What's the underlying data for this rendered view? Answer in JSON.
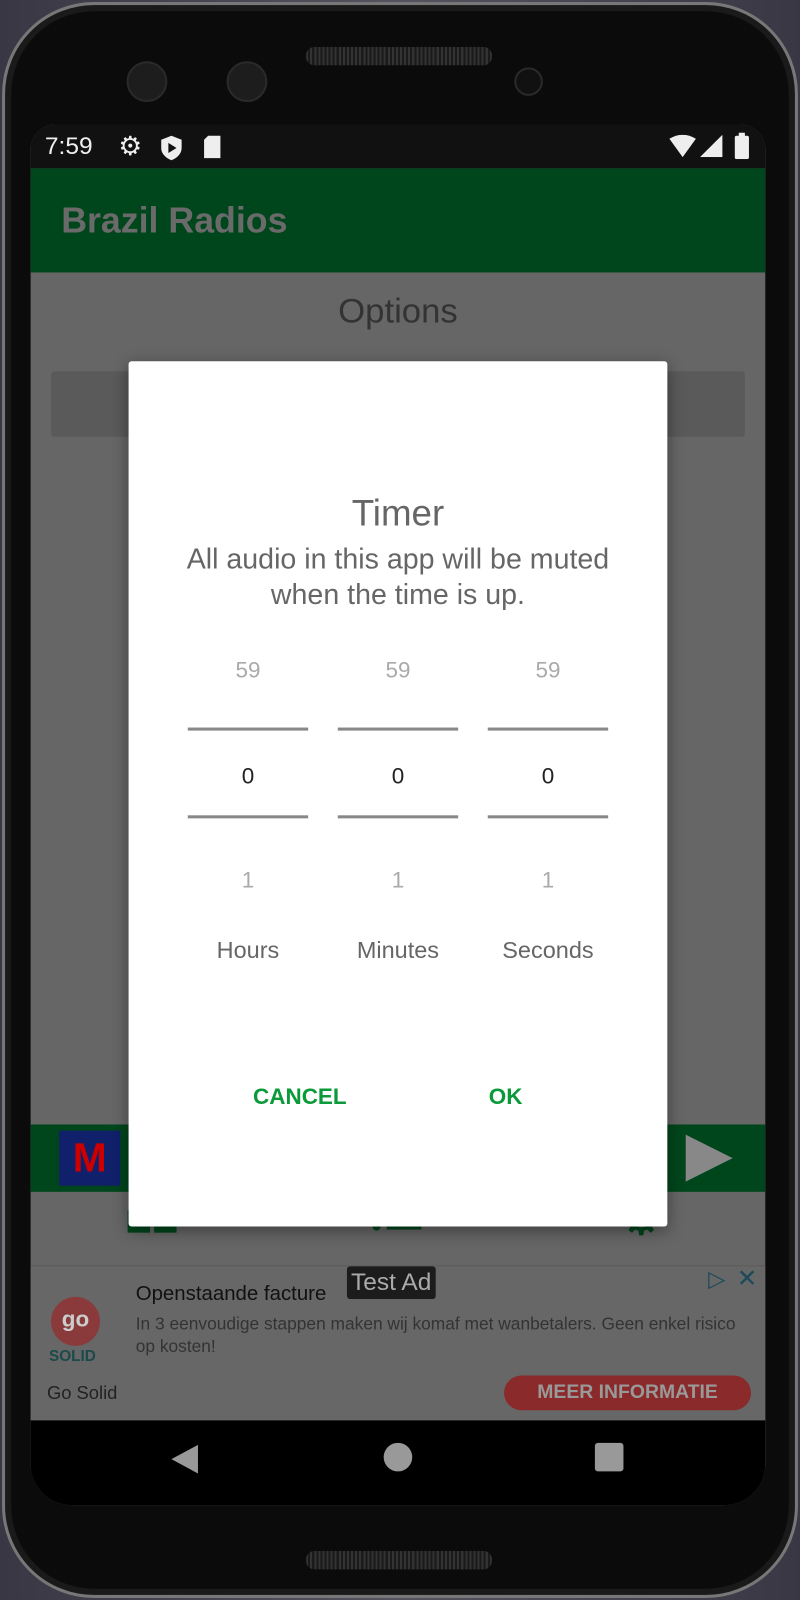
{
  "status_bar": {
    "time": "7:59",
    "icons": [
      "gear-icon",
      "shield-play-icon",
      "sd-card-icon",
      "wifi-icon",
      "signal-icon",
      "battery-icon"
    ]
  },
  "app_bar": {
    "title": "Brazil Radios"
  },
  "page": {
    "title": "Options"
  },
  "dialog": {
    "title": "Timer",
    "message": "All audio in this app will be muted when the time is up.",
    "pickers": [
      {
        "label": "Hours",
        "prev": "59",
        "value": "0",
        "next": "1"
      },
      {
        "label": "Minutes",
        "prev": "59",
        "value": "0",
        "next": "1"
      },
      {
        "label": "Seconds",
        "prev": "59",
        "value": "0",
        "next": "1"
      }
    ],
    "cancel_label": "CANCEL",
    "ok_label": "OK"
  },
  "player": {
    "logo_text": "M",
    "icon": "play-icon"
  },
  "bottom_nav": {
    "icons": [
      "grid-icon",
      "list-icon",
      "gear-icon"
    ]
  },
  "ad": {
    "badge": "Test Ad",
    "headline": "Openstaande facture",
    "body": "In 3 eenvoudige stappen maken wij komaf met wanbetalers. Geen enkel risico op kosten!",
    "advertiser": "Go Solid",
    "logo_top": "go",
    "logo_bottom": "SOLID",
    "cta": "MEER INFORMATIE"
  },
  "colors": {
    "accent": "#0a9a3a",
    "app_bar": "#00461c",
    "cta": "#8a2a2a"
  }
}
